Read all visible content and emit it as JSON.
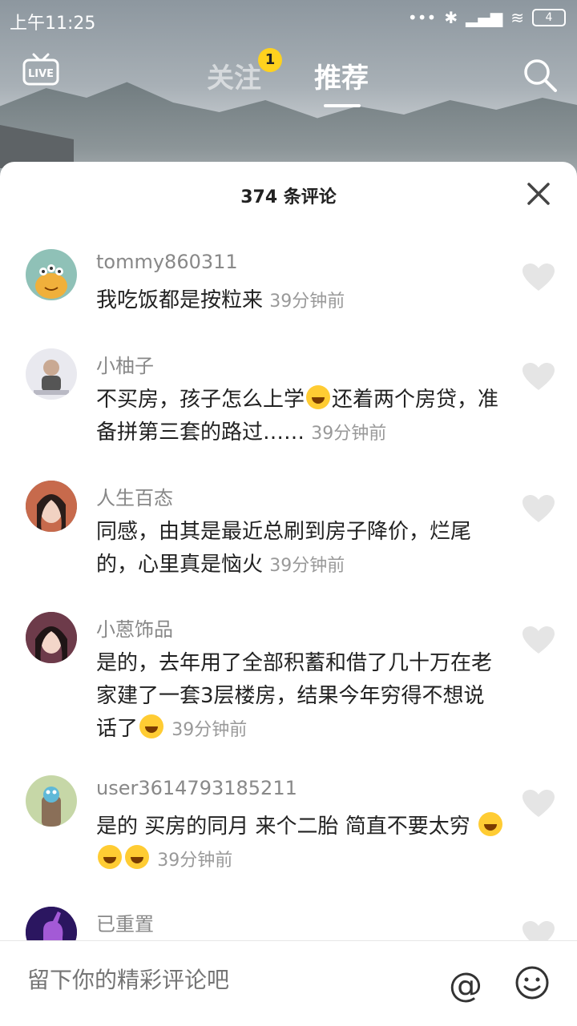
{
  "status": {
    "time": "上午11:25",
    "battery": "4"
  },
  "nav": {
    "live": "LIVE",
    "follow": "关注",
    "follow_badge": "1",
    "recommend": "推荐"
  },
  "sheet": {
    "count_label": "374 条评论"
  },
  "comments": [
    {
      "user": "tommy860311",
      "text": "我吃饭都是按粒来",
      "time": "39分钟前"
    },
    {
      "user": "小柚子",
      "text_a": "不买房，孩子怎么上学",
      "text_b": "还着两个房贷，准备拼第三套的路过……",
      "time": "39分钟前"
    },
    {
      "user": "人生百态",
      "text": "同感，由其是最近总刷到房子降价，烂尾的，心里真是恼火",
      "time": "39分钟前"
    },
    {
      "user": "小蒽饰品",
      "text": "是的，去年用了全部积蓄和借了几十万在老家建了一套3层楼房，结果今年穷得不想说话了",
      "time": "39分钟前"
    },
    {
      "user": "user3614793185211",
      "text": "是的 买房的同月 来个二胎 简直不要太穷 ",
      "time": "39分钟前"
    },
    {
      "user": "已重置"
    }
  ],
  "input": {
    "placeholder": "留下你的精彩评论吧",
    "at": "@"
  },
  "colors": {
    "badge": "#ffd21e",
    "heart": "#e5e5e5",
    "emoji": "#ffcc33"
  }
}
